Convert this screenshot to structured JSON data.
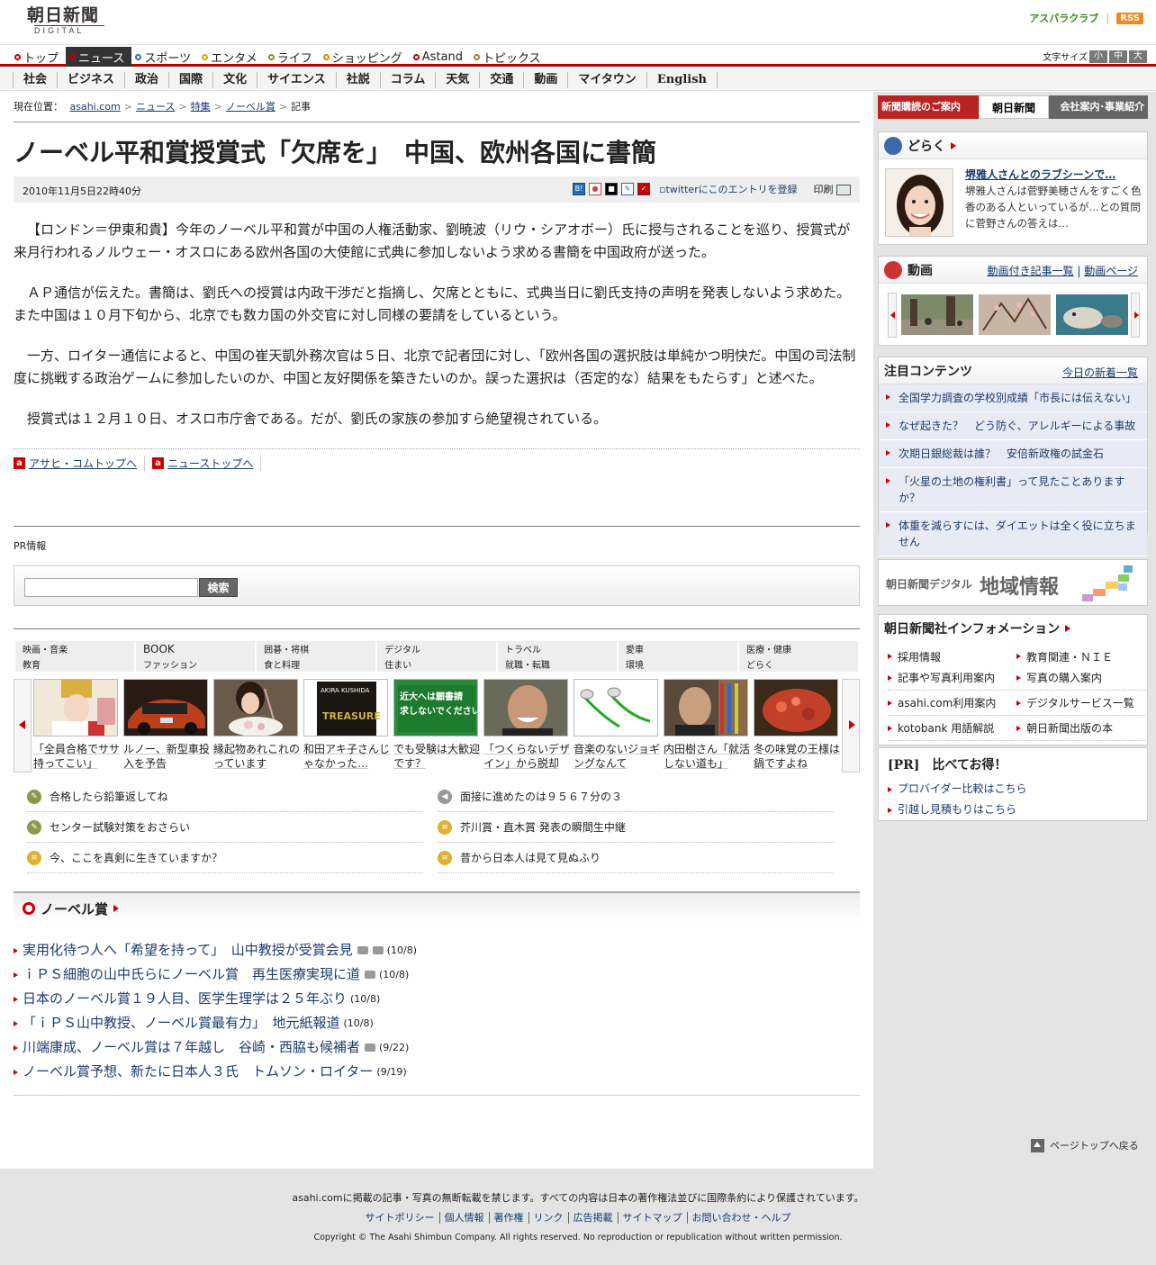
{
  "header": {
    "logo_main": "朝日新聞",
    "logo_sub": "DIGITAL",
    "aspara": "アスパラクラブ",
    "rss": "RSS"
  },
  "global_nav": [
    {
      "label": "トップ",
      "color": "#c00000"
    },
    {
      "label": "ニュース",
      "color": "#c00000",
      "active": true
    },
    {
      "label": "スポーツ",
      "color": "#3a6ab0"
    },
    {
      "label": "エンタメ",
      "color": "#d8a800"
    },
    {
      "label": "ライフ",
      "color": "#6a9a2a"
    },
    {
      "label": "ショッピング",
      "color": "#d88a00"
    },
    {
      "label": "Astand",
      "color": "#c00000"
    },
    {
      "label": "トピックス",
      "color": "#a08040"
    }
  ],
  "font_size": {
    "label": "文字サイズ",
    "small": "小",
    "medium": "中",
    "large": "大"
  },
  "sub_nav": [
    "社会",
    "ビジネス",
    "政治",
    "国際",
    "文化",
    "サイエンス",
    "社説",
    "コラム",
    "天気",
    "交通",
    "動画",
    "マイタウン",
    "English"
  ],
  "breadcrumb": {
    "label": "現在位置：",
    "items": [
      "asahi.com",
      "ニュース",
      "特集",
      "ノーベル賞",
      "記事"
    ]
  },
  "article": {
    "title": "ノーベル平和賞授賞式「欠席を」　中国、欧州各国に書簡",
    "date": "2010年11月5日22時40分",
    "twitter": "twitterにこのエントリを登録",
    "print": "印刷",
    "paragraphs": [
      "【ロンドン＝伊東和貴】今年のノーベル平和賞が中国の人権活動家、劉暁波（リウ・シアオボー）氏に授与されることを巡り、授賞式が来月行われるノルウェー・オスロにある欧州各国の大使館に式典に参加しないよう求める書簡を中国政府が送った。",
      "ＡＰ通信が伝えた。書簡は、劉氏への授賞は内政干渉だと指摘し、欠席とともに、式典当日に劉氏支持の声明を発表しないよう求めた。また中国は１０月下旬から、北京でも数カ国の外交官に対し同様の要請をしているという。",
      "一方、ロイター通信によると、中国の崔天凱外務次官は５日、北京で記者団に対し、「欧州各国の選択肢は単純かつ明快だ。中国の司法制度に挑戦する政治ゲームに参加したいのか、中国と友好関係を築きたいのか。誤った選択は（否定的な）結果をもたらす」と述べた。",
      "授賞式は１２月１０日、オスロ市庁舎である。だが、劉氏の家族の参加すら絶望視されている。"
    ],
    "link_top": "アサヒ・コムトップへ",
    "link_news": "ニューストップへ"
  },
  "pr": {
    "label": "PR情報",
    "search_button": "検索",
    "search_value": ""
  },
  "categories": [
    [
      "映画・音楽",
      "BOOK",
      "囲碁・将棋",
      "デジタル",
      "トラベル",
      "愛車",
      "医療・健康"
    ],
    [
      "教育",
      "ファッション",
      "食と料理",
      "住まい",
      "就職・転職",
      "環境",
      "どらく"
    ]
  ],
  "carousel": [
    {
      "caption": "「全員合格でササ持ってこい」",
      "img": "shrine-maiden"
    },
    {
      "caption": "ルノー、新型車投入を予告",
      "img": "car"
    },
    {
      "caption": "縁起物あれこれのっています",
      "img": "food"
    },
    {
      "caption": "和田アキ子さんじゃなかった…",
      "img": "album",
      "album_text": "AKIRA KUSHIDA",
      "album_word": "TREASURE"
    },
    {
      "caption": "でも受験は大歓迎です？",
      "img": "sign",
      "sign_text": "近大へは願書請求しないでください"
    },
    {
      "caption": "「つくらないデザイン」から脱却",
      "img": "man-smile"
    },
    {
      "caption": "音楽のないジョギングなんて",
      "img": "earphones"
    },
    {
      "caption": "内田樹さん「就活しない道も」",
      "img": "man-books"
    },
    {
      "caption": "冬の味覚の王様は鍋ですよね",
      "img": "crab"
    }
  ],
  "pickups": [
    [
      {
        "text": "合格したら鉛筆返してね",
        "icon": "pencil-icon"
      },
      {
        "text": "面接に進めたのは９５６７分の３",
        "icon": "speaker-icon"
      }
    ],
    [
      {
        "text": "センター試験対策をおさらい",
        "icon": "pencil-icon"
      },
      {
        "text": "芥川賞・直木賞 発表の瞬間生中継",
        "icon": "note-icon"
      }
    ],
    [
      {
        "text": "今、ここを真剣に生きていますか？",
        "icon": "note-icon"
      },
      {
        "text": "昔から日本人は見て見ぬふり",
        "icon": "note-icon"
      }
    ]
  ],
  "nobel": {
    "heading": "ノーベル賞",
    "items": [
      {
        "title": "実用化待つ人へ「希望を持って」　山中教授が受賞会見",
        "date": "(10/8)",
        "photo": true,
        "video": true
      },
      {
        "title": "ｉＰＳ細胞の山中氏らにノーベル賞　再生医療実現に道",
        "date": "(10/8)",
        "photo": true
      },
      {
        "title": "日本のノーベル賞１９人目、医学生理学は２５年ぶり",
        "date": "(10/8)"
      },
      {
        "title": "「ｉＰＳ山中教授、ノーベル賞最有力」　地元紙報道",
        "date": "(10/8)"
      },
      {
        "title": "川端康成、ノーベル賞は７年越し　谷崎・西脇も候補者",
        "date": "(9/22)",
        "photo": true
      },
      {
        "title": "ノーベル賞予想、新たに日本人３氏　トムソン・ロイター",
        "date": "(9/19)"
      }
    ]
  },
  "sidebar": {
    "banner": {
      "b1": "新聞購読のご案内",
      "b2": "朝日新聞",
      "b3": "会社案内･事業紹介"
    },
    "doraku": {
      "heading": "どらく",
      "title": "堺雅人さんとのラブシーンで…",
      "text": "堺雅人さんは菅野美穂さんをすごく色香のある人といっているが…との質問に菅野さんの答えは…"
    },
    "video": {
      "heading": "動画",
      "link1": "動画付き記事一覧",
      "link2": "動画ページ"
    },
    "chumoku": {
      "heading": "注目コンテンツ",
      "more": "今日の新着一覧",
      "items": [
        "全国学力調査の学校別成績「市長には伝えない」",
        "なぜ起きた？　どう防ぐ、アレルギーによる事故",
        "次期日銀総裁は誰？　安倍新政権の試金石",
        "「火星の土地の権利書」って見たことありますか？",
        "体重を減らすには、ダイエットは全く役に立ちません"
      ]
    },
    "chiiki": {
      "t1": "朝日新聞デジタル",
      "t2": "地域情報"
    },
    "info": {
      "heading": "朝日新聞社インフォメーション",
      "items": [
        [
          "採用情報",
          "教育関連・ＮＩＥ"
        ],
        [
          "記事や写真利用案内",
          "写真の購入案内"
        ],
        [
          "asahi.com利用案内",
          "デジタルサービス一覧"
        ],
        [
          "kotobank 用語解説",
          "朝日新聞出版の本"
        ]
      ]
    },
    "pr": {
      "heading": "[PR]　比べてお得！",
      "items": [
        "プロバイダー比較はこちら",
        "引越し見積もりはこちら"
      ]
    },
    "pagetop": "ページトップへ戻る"
  },
  "footer": {
    "notice": "asahi.comに掲載の記事・写真の無断転載を禁じます。すべての内容は日本の著作権法並びに国際条約により保護されています。",
    "links": [
      "サイトポリシー",
      "個人情報",
      "著作権",
      "リンク",
      "広告掲載",
      "サイトマップ",
      "お問い合わせ・ヘルプ"
    ],
    "copyright": "Copyright © The Asahi Shimbun Company. All rights reserved. No reproduction or republication without written permission."
  }
}
